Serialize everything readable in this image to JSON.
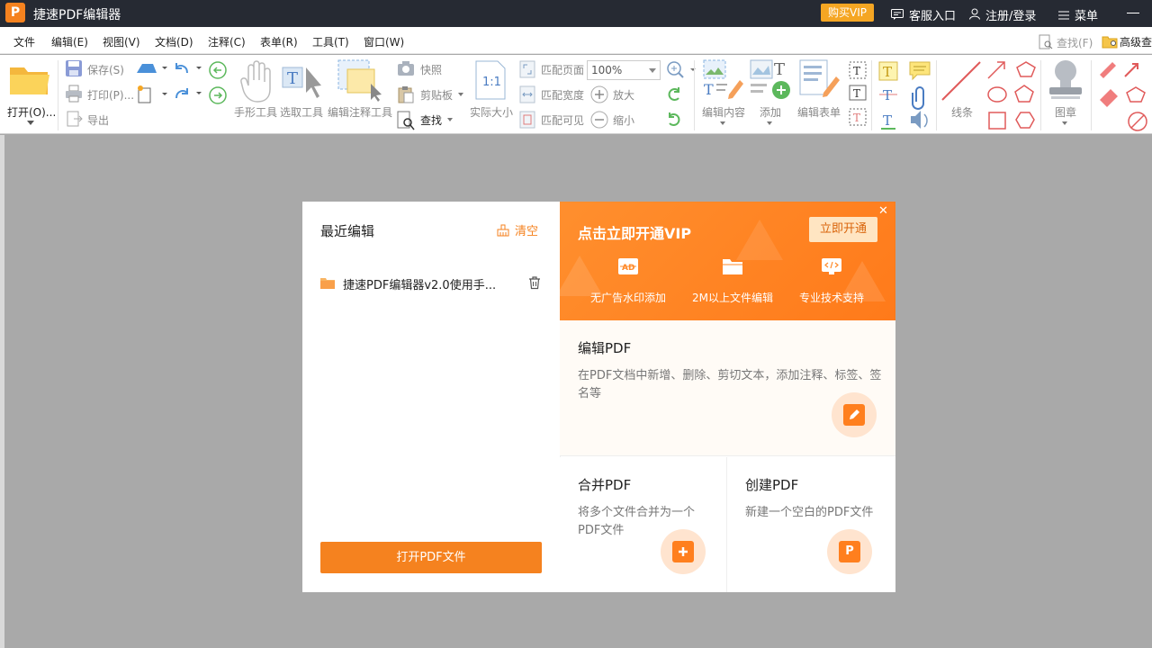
{
  "app": {
    "logo_letter": "P",
    "title": "捷速PDF编辑器",
    "vip_button": "购买VIP",
    "service": "客服入口",
    "login": "注册/登录",
    "menu": "菜单"
  },
  "menubar": {
    "items": [
      "文件",
      "编辑(E)",
      "视图(V)",
      "文档(D)",
      "注释(C)",
      "表单(R)",
      "工具(T)",
      "窗口(W)"
    ],
    "search": "查找(F)",
    "advanced": "高级查"
  },
  "ribbon": {
    "open": "打开(O)...",
    "save": "保存(S)",
    "print": "打印(P)...",
    "export": "导出",
    "hand_tool": "手形工具",
    "select_tool": "选取工具",
    "edit_annot_tool": "编辑注释工具",
    "snapshot": "快照",
    "clipboard": "剪贴板",
    "find": "查找",
    "actual_size": "实际大小",
    "fit_page": "匹配页面",
    "fit_width": "匹配宽度",
    "fit_visible": "匹配可见",
    "zoom_value": "100%",
    "zoom_in": "放大",
    "zoom_out": "缩小",
    "edit_content": "编辑内容",
    "add": "添加",
    "edit_form": "编辑表单",
    "lines": "线条",
    "stamp": "图章"
  },
  "dialog": {
    "recent_title": "最近编辑",
    "clear": "清空",
    "recent_file": "捷速PDF编辑器v2.0使用手...",
    "open_button": "打开PDF文件",
    "vip_title": "点击立即开通VIP",
    "vip_open": "立即开通",
    "features": [
      "无广告水印添加",
      "2M以上文件编辑",
      "专业技术支持"
    ],
    "edit_title": "编辑PDF",
    "edit_desc": "在PDF文档中新增、删除、剪切文本，添加注释、标签、签名等",
    "merge_title": "合并PDF",
    "merge_desc": "将多个文件合并为一个PDF文件",
    "create_title": "创建PDF",
    "create_desc": "新建一个空白的PDF文件",
    "create_badge": "P"
  },
  "colors": {
    "accent": "#f5821f",
    "titlebar": "#262a33",
    "vip_gold": "#f5a623"
  }
}
